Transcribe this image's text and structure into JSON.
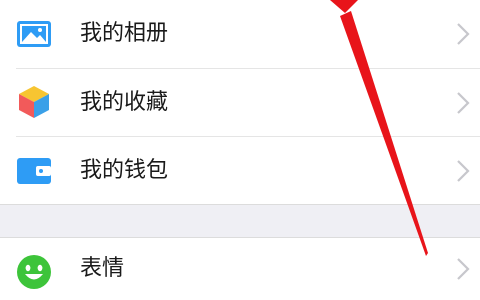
{
  "menu": {
    "items": [
      {
        "label": "我的相册",
        "icon": "photo-album-icon"
      },
      {
        "label": "我的收藏",
        "icon": "favorites-cube-icon"
      },
      {
        "label": "我的钱包",
        "icon": "wallet-icon"
      },
      {
        "label": "表情",
        "icon": "emoji-smiley-icon"
      }
    ]
  },
  "colors": {
    "album_blue": "#2e9cf5",
    "wallet_blue": "#2e9cf5",
    "emoji_green": "#3dc43a",
    "cube_red": "#f25a5a",
    "cube_yellow": "#f7c531",
    "cube_blue": "#3aa0e8",
    "annotation_red": "#e8141a",
    "separator_gray": "#efeff4"
  }
}
